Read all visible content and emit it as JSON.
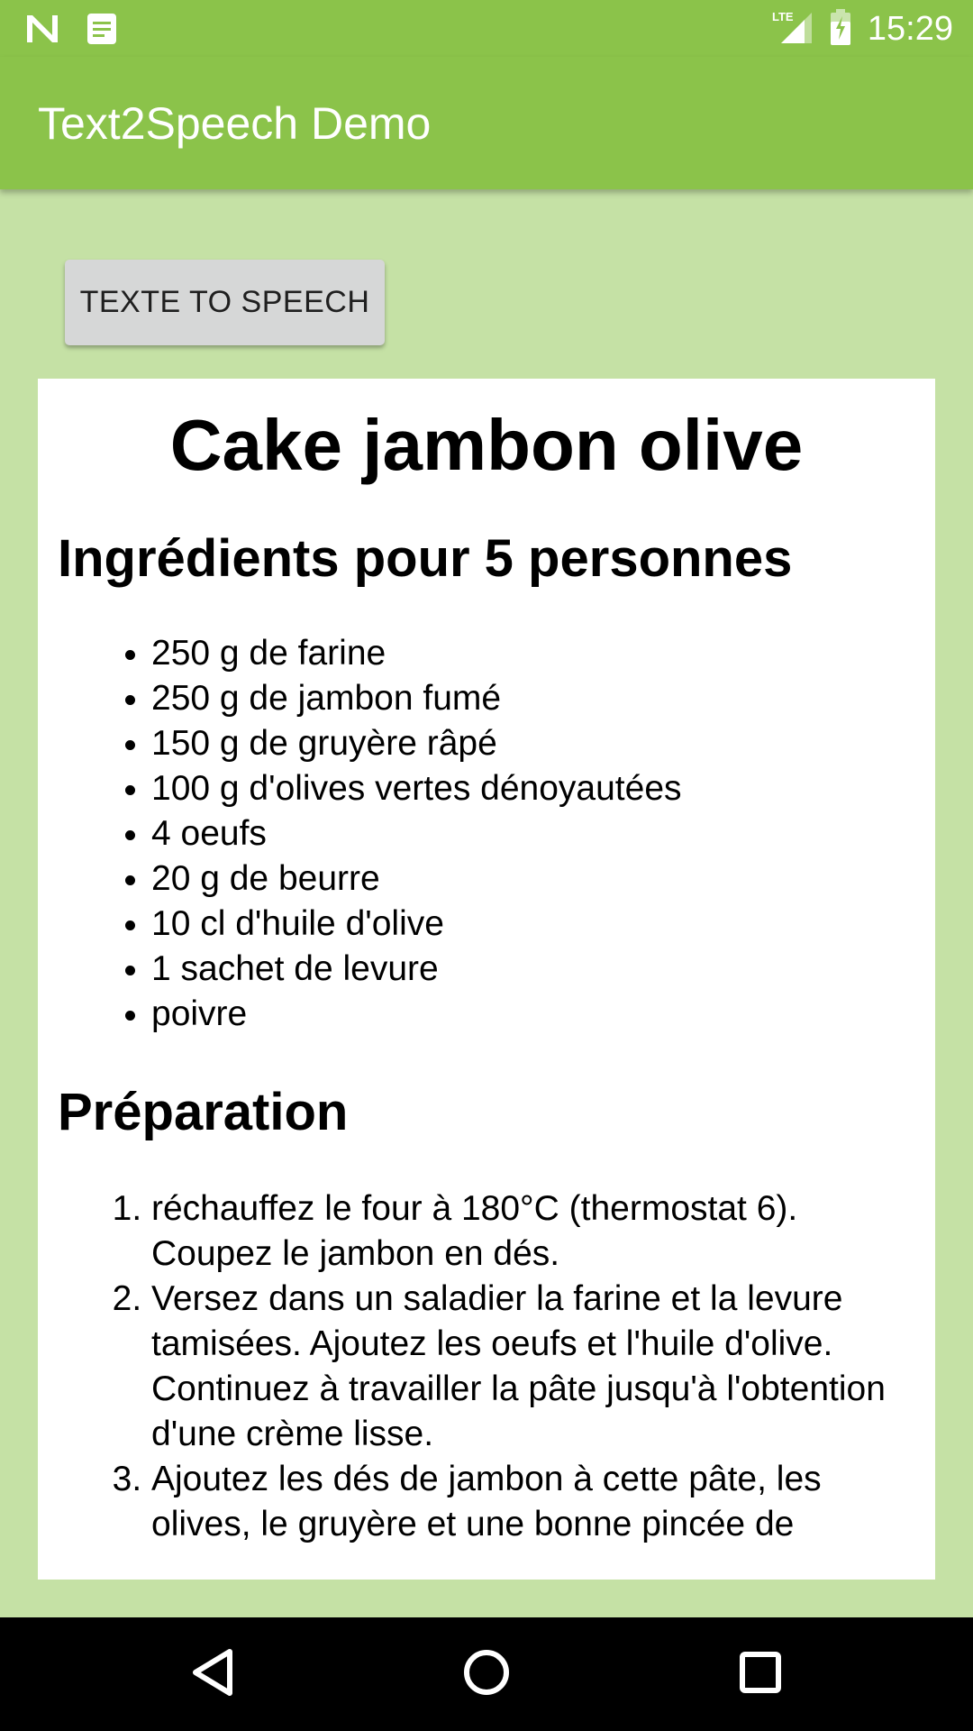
{
  "status_bar": {
    "time": "15:29",
    "left_icons": [
      "n-icon",
      "notes-icon"
    ],
    "right_icons": [
      "lte-signal-icon",
      "battery-icon"
    ]
  },
  "app_bar": {
    "title": "Text2Speech Demo",
    "color": "#8BC34A"
  },
  "button": {
    "label": "TEXTE TO SPEECH"
  },
  "recipe": {
    "title": "Cake jambon olive",
    "ingredients_heading": "Ingrédients pour 5 personnes",
    "ingredients": [
      "250 g de farine",
      "250 g de jambon fumé",
      "150 g de gruyère râpé",
      "100 g d'olives vertes dénoyautées",
      "4 oeufs",
      "20 g de beurre",
      "10 cl d'huile d'olive",
      "1 sachet de levure",
      "poivre"
    ],
    "preparation_heading": "Préparation",
    "steps": [
      "réchauffez le four à 180°C (thermostat 6). Coupez le jambon en dés.",
      "Versez dans un saladier la farine et la levure tamisées. Ajoutez les oeufs et l'huile d'olive. Continuez à travailler la pâte jusqu'à l'obtention d'une crème lisse.",
      "Ajoutez les dés de jambon à cette pâte, les olives, le gruyère et une bonne pincée de"
    ]
  },
  "nav_bar": {
    "buttons": [
      "back-icon",
      "home-icon",
      "recents-icon"
    ]
  },
  "colors": {
    "accent": "#8BC34A",
    "background": "#C5E1A5",
    "button": "#D6D7D7",
    "nav_bar": "#000000"
  }
}
